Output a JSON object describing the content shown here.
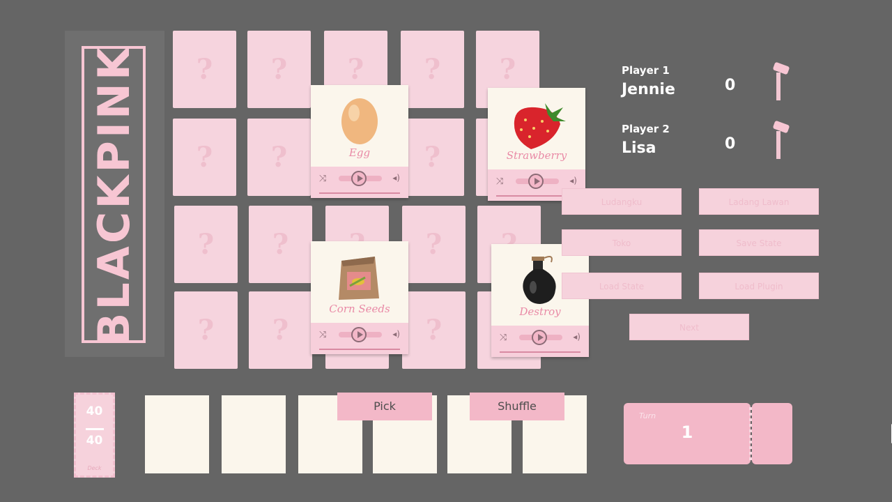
{
  "logo": {
    "text": "BLACKPINK"
  },
  "grid": {
    "hidden_symbol": "?",
    "rows": 4,
    "cols": 5
  },
  "revealed_cards": [
    {
      "name": "Egg",
      "icon": "egg-icon"
    },
    {
      "name": "Strawberry",
      "icon": "strawberry-icon"
    },
    {
      "name": "Corn Seeds",
      "icon": "seed-bag-icon"
    },
    {
      "name": "Destroy",
      "icon": "potion-bottle-icon"
    }
  ],
  "players": [
    {
      "label": "Player 1",
      "name": "Jennie",
      "score": "0",
      "icon": "hammer-icon"
    },
    {
      "label": "Player 2",
      "name": "Lisa",
      "score": "0",
      "icon": "hammer-icon"
    }
  ],
  "menu": {
    "ludangku": "Ludangku",
    "ladang_lawan": "Ladang Lawan",
    "toko": "Toko",
    "save_state": "Save State",
    "load_state": "Load State",
    "load_plugin": "Load Plugin",
    "next": "Next"
  },
  "deck": {
    "current": "40",
    "total": "40",
    "caption": "Deck"
  },
  "actions": {
    "pick": "Pick",
    "shuffle": "Shuffle"
  },
  "turn": {
    "label": "Turn",
    "value": "1",
    "icon": "fast-forward-icon"
  },
  "colors": {
    "background": "#656565",
    "card_pink": "#f6d4de",
    "accent_pink": "#f3b8c8",
    "cream": "#fbf6ec"
  }
}
